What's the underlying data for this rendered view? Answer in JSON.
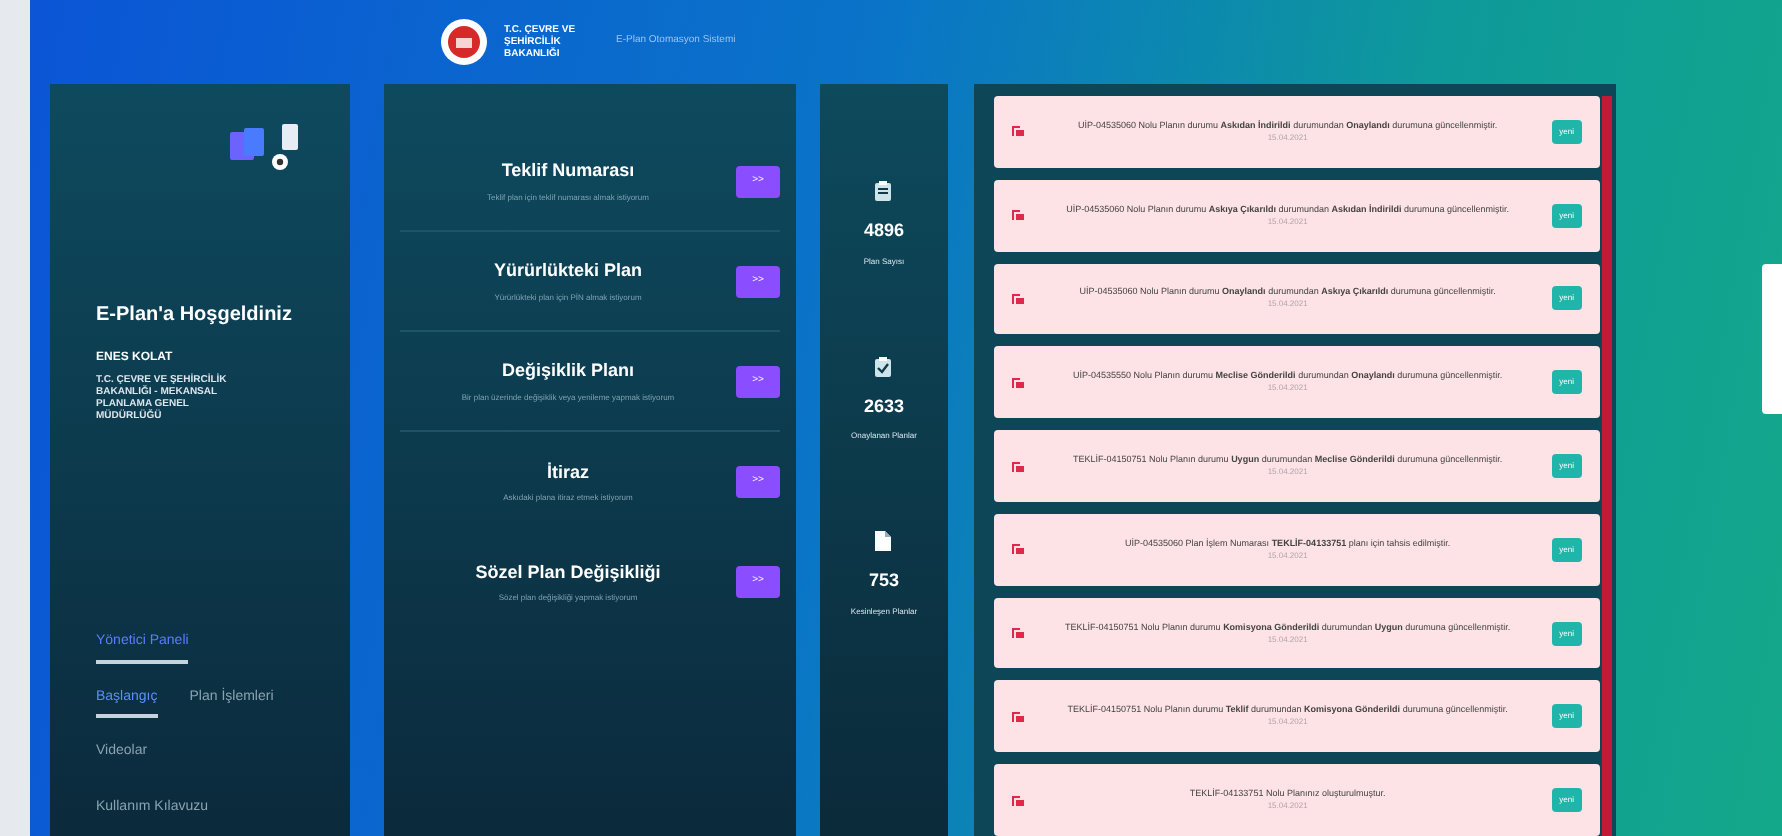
{
  "header": {
    "ministry": "T.C. ÇEVRE VE ŞEHİRCİLİK BAKANLIĞI",
    "system": "E-Plan Otomasyon Sistemi"
  },
  "profile": {
    "welcome": "E-Plan'a Hoşgeldiniz",
    "user": "ENES KOLAT",
    "institution": "T.C. ÇEVRE VE ŞEHİRCİLİK BAKANLIĞI - MEKANSAL PLANLAMA GENEL MÜDÜRLÜĞÜ"
  },
  "panel_label": "Yönetici Paneli",
  "nav": [
    {
      "label": "Başlangıç",
      "selected": true,
      "kind": "tab"
    },
    {
      "label": "Plan İşlemleri",
      "selected": false,
      "kind": "tab"
    },
    {
      "label": "Videolar",
      "selected": false,
      "kind": "link"
    },
    {
      "label": "Kullanım Kılavuzu",
      "selected": false,
      "kind": "link"
    }
  ],
  "actions": [
    {
      "title": "Teklif Numarası",
      "description": "Teklif plan için teklif numarası almak istiyorum",
      "button": ">>"
    },
    {
      "title": "Yürürlükteki Plan",
      "description": "Yürürlükteki plan için PİN almak istiyorum",
      "button": ">>"
    },
    {
      "title": "Değişiklik Planı",
      "description": "Bir plan üzerinde değişiklik veya yenileme yapmak istiyorum",
      "button": ">>"
    },
    {
      "title": "İtiraz",
      "description": "Askıdaki plana itiraz etmek istiyorum",
      "button": ">>"
    },
    {
      "title": "Sözel Plan Değişikliği",
      "description": "Sözel plan değişikliği yapmak istiyorum",
      "button": ">>"
    }
  ],
  "stats": [
    {
      "kind": "clipboard",
      "value": "4896",
      "label": "Plan Sayısı"
    },
    {
      "kind": "check",
      "value": "2633",
      "label": "Onaylanan Planlar"
    },
    {
      "kind": "file",
      "value": "753",
      "label": "Kesinleşen Planlar"
    }
  ],
  "notifications": [
    {
      "text": "UİP-04535060 Nolu Planın durumu **Askıdan İndirildi** durumundan **Onaylandı** durumuna güncellenmiştir.",
      "date": "15.04.2021",
      "badge": "yeni"
    },
    {
      "text": "UİP-04535060 Nolu Planın durumu **Askıya Çıkarıldı** durumundan **Askıdan İndirildi** durumuna güncellenmiştir.",
      "date": "15.04.2021",
      "badge": "yeni"
    },
    {
      "text": "UİP-04535060 Nolu Planın durumu **Onaylandı** durumundan **Askıya Çıkarıldı** durumuna güncellenmiştir.",
      "date": "15.04.2021",
      "badge": "yeni"
    },
    {
      "text": "UİP-04535550 Nolu Planın durumu **Meclise Gönderildi** durumundan **Onaylandı** durumuna güncellenmiştir.",
      "date": "15.04.2021",
      "badge": "yeni"
    },
    {
      "text": "TEKLİF-04150751 Nolu Planın durumu **Uygun** durumundan **Meclise Gönderildi** durumuna güncellenmiştir.",
      "date": "15.04.2021",
      "badge": "yeni"
    },
    {
      "text": "UİP-04535060 Plan İşlem Numarası **TEKLİF-04133751** planı için tahsis edilmiştir.",
      "date": "15.04.2021",
      "badge": "yeni"
    },
    {
      "text": "TEKLİF-04150751 Nolu Planın durumu **Komisyona Gönderildi** durumundan **Uygun** durumuna güncellenmiştir.",
      "date": "15.04.2021",
      "badge": "yeni"
    },
    {
      "text": "TEKLİF-04150751 Nolu Planın durumu **Teklif** durumundan **Komisyona Gönderildi** durumuna güncellenmiştir.",
      "date": "15.04.2021",
      "badge": "yeni"
    },
    {
      "text": "TEKLİF-04133751 Nolu Planınız oluşturulmuştur.",
      "date": "15.04.2021",
      "badge": "yeni"
    }
  ]
}
